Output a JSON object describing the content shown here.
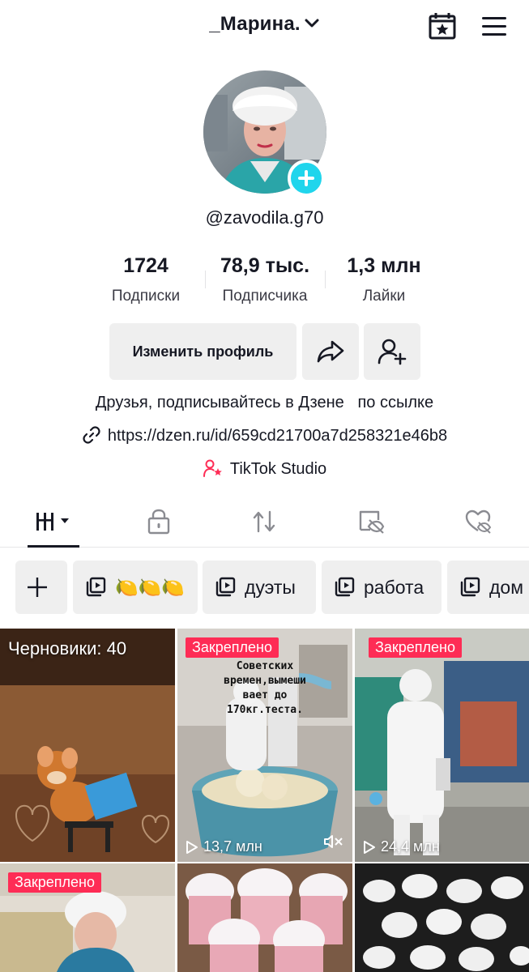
{
  "header": {
    "title": "_Марина.",
    "icons": [
      "chevron-down-icon",
      "calendar-star-icon",
      "hamburger-menu-icon"
    ]
  },
  "profile": {
    "handle": "@zavodila.g70",
    "stats": [
      {
        "value": "1724",
        "label": "Подписки"
      },
      {
        "value": "78,9 тыс.",
        "label": "Подписчика"
      },
      {
        "value": "1,3 млн",
        "label": "Лайки"
      }
    ],
    "edit_label": "Изменить профиль",
    "bio": "Друзья, подписывайтесь в Дзене   по ссылке",
    "link": "https://dzen.ru/id/659cd21700a7d258321e46b8",
    "studio": "TikTok Studio"
  },
  "tabs": [
    "videos-grid-icon",
    "lock-icon",
    "repost-icon",
    "hidden-icon",
    "liked-icon"
  ],
  "collections": [
    {
      "label": "🍋🍋🍋"
    },
    {
      "label": "дуэты"
    },
    {
      "label": "работа"
    },
    {
      "label": "дом"
    }
  ],
  "grid": {
    "drafts_label": "Черновики: 40",
    "pinned_label": "Закреплено",
    "tile2_text": "Советских\nвремен,вымеши\nвает до\n170кг.теста.",
    "tile2_views": "13,7 млн",
    "tile3_views": "24,4 млн"
  },
  "colors": {
    "accent_red": "#fe2c55",
    "accent_cyan": "#20d5ec",
    "button_bg": "#efefef",
    "text": "#161823"
  }
}
